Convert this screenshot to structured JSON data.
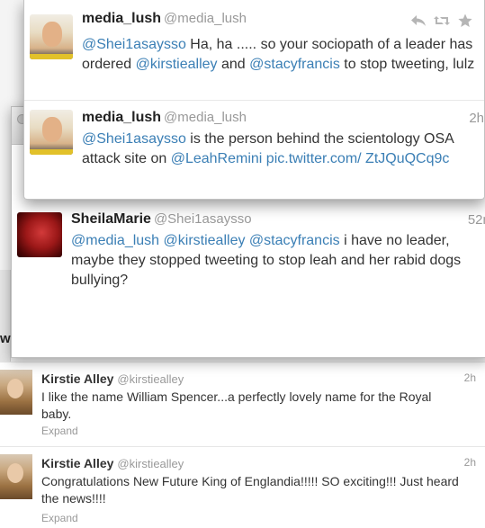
{
  "timeline": {
    "partial_text": "w",
    "tweets": [
      {
        "name": "Kirstie Alley",
        "handle": "@kirstiealley",
        "time": "2h",
        "text": "I like the name William Spencer...a perfectly lovely name for the Royal baby.",
        "expand": "Expand"
      },
      {
        "name": "Kirstie Alley",
        "handle": "@kirstiealley",
        "time": "2h",
        "text": "Congratulations New Future King of Englandia!!!!! SO exciting!!! Just heard the news!!!!",
        "expand": "Expand"
      }
    ]
  },
  "conversation": {
    "sheila": {
      "name": "SheilaMarie",
      "handle": "@Shei1asaysso",
      "time": "52m",
      "mentions": [
        "@media_lush",
        "@kirstiealley",
        "@stacyfrancis"
      ],
      "text": " i have no leader, maybe they stopped tweeting to stop leah and her rabid dogs bullying?"
    }
  },
  "popup": {
    "tweets": [
      {
        "name": "media_lush",
        "handle": "@media_lush",
        "time": "",
        "m1": "@Shei1asaysso",
        "t1": " Ha, ha ..... so your sociopath of a leader has ordered ",
        "m2": "@kirstiealley",
        "t2": "  and ",
        "m3": "@stacyfrancis",
        "t3": " to stop tweeting, lulz"
      },
      {
        "name": "media_lush",
        "handle": "@media_lush",
        "time": "2h",
        "m1": "@Shei1asaysso",
        "t1": " is the person behind the scientology OSA attack site on ",
        "m2": "@LeahRemini",
        "t2": " ",
        "m3": "pic.twitter.com/ ZtJQuQCq9c",
        "t3": ""
      }
    ],
    "actions": [
      {
        "icon": "reply-icon"
      },
      {
        "icon": "retweet-icon"
      },
      {
        "icon": "favorite-star-icon"
      }
    ]
  },
  "colors": {
    "link": "#3b7fb5",
    "muted": "#999999",
    "text": "#333333"
  }
}
